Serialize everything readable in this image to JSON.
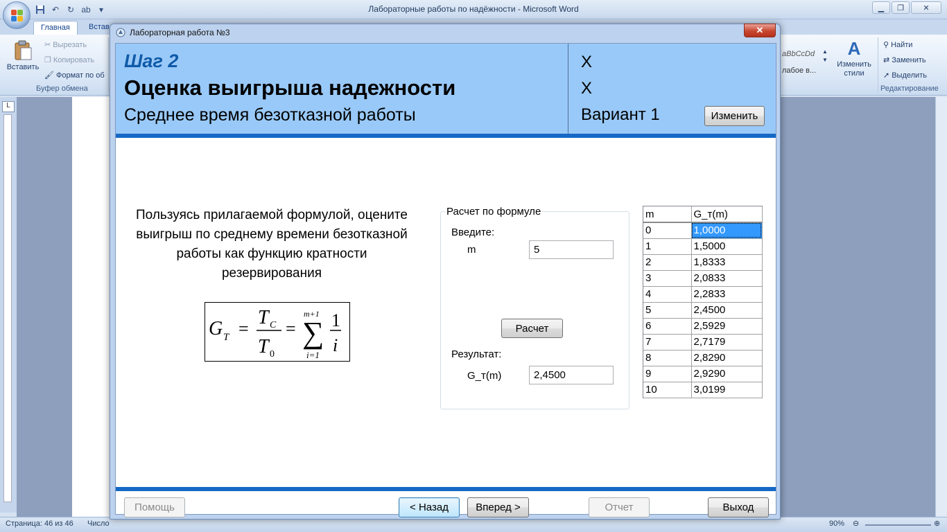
{
  "word": {
    "window_title": "Лабораторные работы по надёжности - Microsoft Word",
    "tabs": [
      "Главная",
      "Встав"
    ],
    "clipboard": {
      "paste": "Вставить",
      "cut": "Вырезать",
      "copy": "Копировать",
      "format": "Формат по об",
      "group": "Буфер обмена"
    },
    "styles_preview": "aBbCcDd",
    "styles_item": "лабое в...",
    "change_styles": "Изменить стили",
    "editing": {
      "find": "Найти",
      "replace": "Заменить",
      "select": "Выделить",
      "group": "Редактирование"
    },
    "status": {
      "page": "Страница: 46 из 46",
      "words": "Число",
      "zoom": "90%"
    },
    "ruler_corner": "L"
  },
  "dialog": {
    "title": "Лабораторная работа №3",
    "close_symbol": "✕",
    "header": {
      "step": "Шаг 2",
      "title": "Оценка выигрыша надежности",
      "subtitle": "Среднее время безотказной работы",
      "x1": "X",
      "x2": "X",
      "variant": "Вариант 1",
      "change_label": "Изменить"
    },
    "instruction": "Пользуясь прилагаемой формулой, оцените выигрыш по среднему времени безотказной работы как функцию кратности резервирования",
    "formula": {
      "lhs": "G",
      "lhs_sub": "T",
      "num": "T",
      "num_sub": "C",
      "den": "T",
      "den_sub": "0",
      "sum_upper": "m+1",
      "sum_lower": "i=1",
      "frac_num": "1",
      "frac_den": "i",
      "eq": "="
    },
    "calc": {
      "legend": "Расчет по формуле",
      "enter_label": "Введите:",
      "m_label": "m",
      "m_value": "5",
      "button": "Расчет",
      "result_label": "Результат:",
      "g_label": "G_т(m)",
      "g_value": "2,4500"
    },
    "table": {
      "headers": [
        "m",
        "G_т(m)"
      ],
      "rows": [
        [
          "0",
          "1,0000"
        ],
        [
          "1",
          "1,5000"
        ],
        [
          "2",
          "1,8333"
        ],
        [
          "3",
          "2,0833"
        ],
        [
          "4",
          "2,2833"
        ],
        [
          "5",
          "2,4500"
        ],
        [
          "6",
          "2,5929"
        ],
        [
          "7",
          "2,7179"
        ],
        [
          "8",
          "2,8290"
        ],
        [
          "9",
          "2,9290"
        ],
        [
          "10",
          "3,0199"
        ]
      ],
      "selected_row": 0
    },
    "footer": {
      "help": "Помощь",
      "back": "< Назад",
      "next": "Вперед >",
      "report": "Отчет",
      "exit": "Выход"
    }
  }
}
